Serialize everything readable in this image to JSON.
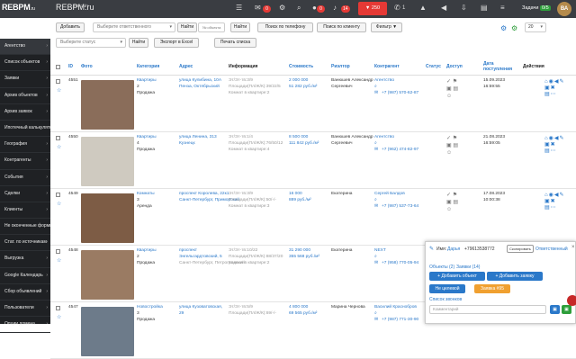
{
  "topbar": {
    "logo": "REBPM",
    "logo_suffix": ".ru",
    "site": "REBPM.ru",
    "site_sub": "На сайт",
    "badge_mail": "0",
    "badge_chat": "0",
    "badge_bell": "14",
    "red_button": "250",
    "count_phone": "1",
    "tasks_label": "Задачи",
    "tasks_badge": "0/5",
    "user_initials": "ВА"
  },
  "sidebar": {
    "items": [
      {
        "label": "Агентство",
        "active": true
      },
      {
        "label": "Список объектов",
        "active": false
      },
      {
        "label": "Заявки",
        "active": false
      },
      {
        "label": "Архив объектов",
        "active": false
      },
      {
        "label": "Архив заявок",
        "active": false
      },
      {
        "label": "Ипотечный калькулятор",
        "active": false
      },
      {
        "label": "География",
        "active": false
      },
      {
        "label": "Контрагенты",
        "active": false
      },
      {
        "label": "События",
        "active": false
      },
      {
        "label": "Сделки",
        "active": false
      },
      {
        "label": "Клиенты",
        "active": false
      },
      {
        "label": "Не оконченные формы",
        "active": false
      },
      {
        "label": "Стат. по источникам",
        "active": false
      },
      {
        "label": "Выгрузка",
        "active": false
      },
      {
        "label": "Google Календарь",
        "active": false
      },
      {
        "label": "Сбор объявлений",
        "active": false
      },
      {
        "label": "Пользователи",
        "active": false
      },
      {
        "label": "Опции домена",
        "active": false
      }
    ]
  },
  "filters": {
    "add_button": "Добавить",
    "responsible_placeholder": "Выберите ответственного",
    "find_button": "Найти",
    "object_number_placeholder": "№ объекта",
    "find_button2": "Найти",
    "by_phone_button": "Поиск по телефону",
    "by_client_button": "Поиск по клиенту",
    "filter_button": "Фильтр",
    "status_placeholder": "Выберите статус",
    "find_button3": "Найти",
    "export_button": "Экспорт в Excel",
    "print_button": "Печать списка",
    "per_page": "20"
  },
  "table": {
    "headers": {
      "id": "ID",
      "photo": "Фото",
      "category": "Категория",
      "address": "Адрес",
      "info": "Информация",
      "price": "Стоимость",
      "realtor": "Риэлтор",
      "contractor": "Контрагент",
      "status": "Статус",
      "access": "Доступ",
      "date_added": "Дата поступления",
      "actions": "Действия"
    },
    "rows": [
      {
        "id": "4551",
        "category": [
          "Квартиры",
          "2",
          "Продажа"
        ],
        "address": [
          "улица Кулибина, 10А",
          "Пенза, Октябрьский"
        ],
        "info": [
          "Эт/Эт-тв:3/9",
          "Площади(Пл/Ж/К):39/22/5",
          "Комнат в квартире:2"
        ],
        "price": [
          "2 000 000",
          "51 282 руб./м²"
        ],
        "realtor": [
          "Ванюшев Александр",
          "Сергеевич"
        ],
        "contractor": [
          "Агентство",
          "+7 (987) 570-62-87"
        ],
        "date": [
          "15.09.2023",
          "16:59:55"
        ],
        "photo": "#8a6d5a"
      },
      {
        "id": "4550",
        "category": [
          "Квартиры",
          "4",
          "Продажа"
        ],
        "address": [
          "улица Ленина, 313",
          "Кузнецк"
        ],
        "info": [
          "Эт/Эт-тв:1/4",
          "Площади(Пл/Ж/К):76/50/12",
          "Комнат в квартире:4"
        ],
        "price": [
          "8 500 000",
          "111 842 руб./м²"
        ],
        "realtor": [
          "Ванюшев Александр",
          "Сергеевич"
        ],
        "contractor": [
          "Агентство",
          "+7 (962) 474-82-97"
        ],
        "date": [
          "21.08.2023",
          "16:59:05"
        ],
        "photo": "#cfcac0"
      },
      {
        "id": "4549",
        "category": [
          "Комнаты",
          "3",
          "Аренда"
        ],
        "address": [
          "проспект Королева, 22к1",
          "Санкт-Петербург, Приморский"
        ],
        "info": [
          "Эт/Эт-тв:3/9",
          "Площади(Пл/Ж/К):50/-/-",
          "Комнат в квартире:3"
        ],
        "price": [
          "16 000",
          "889 руб./м²"
        ],
        "realtor": [
          "Екатерина",
          ""
        ],
        "contractor": [
          "Сергей Балдов",
          "+7 (987) 537-73-64"
        ],
        "date": [
          "17.08.2023",
          "10:00:38"
        ],
        "photo": "#7d5c45"
      },
      {
        "id": "4548",
        "category": [
          "Квартиры",
          "2",
          "Продажа"
        ],
        "address": [
          "проспект",
          "Энгельгардтовский, 5",
          "Санкт-Петербург, Петроградский"
        ],
        "info": [
          "Эт/Эт-тв:10/22",
          "Площади(Пл/Ж/К):88/37/20",
          "Комнат в квартире:2"
        ],
        "price": [
          "31 290 000",
          "355 568 руб./м²"
        ],
        "realtor": [
          "Екатерина",
          ""
        ],
        "contractor": [
          "NEXT",
          "+7 (958) 770-05-94"
        ],
        "date": [
          "",
          ""
        ],
        "photo": "#9a7b63"
      },
      {
        "id": "4547",
        "category": [
          "Новостройка",
          "3",
          "Продажа"
        ],
        "address": [
          "улица Кузоватовская,",
          "29"
        ],
        "info": [
          "Эт/Эт-тв:5/9",
          "Площади(Пл/Ж/К):69/-/-",
          ""
        ],
        "price": [
          "4 800 000",
          "69 565 руб./м²"
        ],
        "realtor": [
          "Марина Чернова",
          ""
        ],
        "contractor": [
          "Василий Краснобров",
          "+7 (987) 771-30-90"
        ],
        "date": [
          "",
          ""
        ],
        "photo": "#6d7b8a"
      }
    ]
  },
  "popup": {
    "name_label": "Имя:",
    "name": "Дарья",
    "phone": "+79613538772",
    "copy_button": "Скопировать",
    "responsible": "Ответственный",
    "objects_link": "Объекты (2)",
    "requests_link": "Заявки (14)",
    "add_object": "+ Добавить объект",
    "add_request": "+ Добавить заявку",
    "not_target": "Не целевой",
    "request_num": "Заявка #95",
    "calls_link": "Список звонков",
    "comment_placeholder": "Комментарий"
  },
  "colors": {
    "accent": "#2a78c9",
    "danger": "#e53935",
    "success": "#2e9e3b",
    "sidebar": "#1f2124",
    "topbar": "#3a3d42"
  }
}
